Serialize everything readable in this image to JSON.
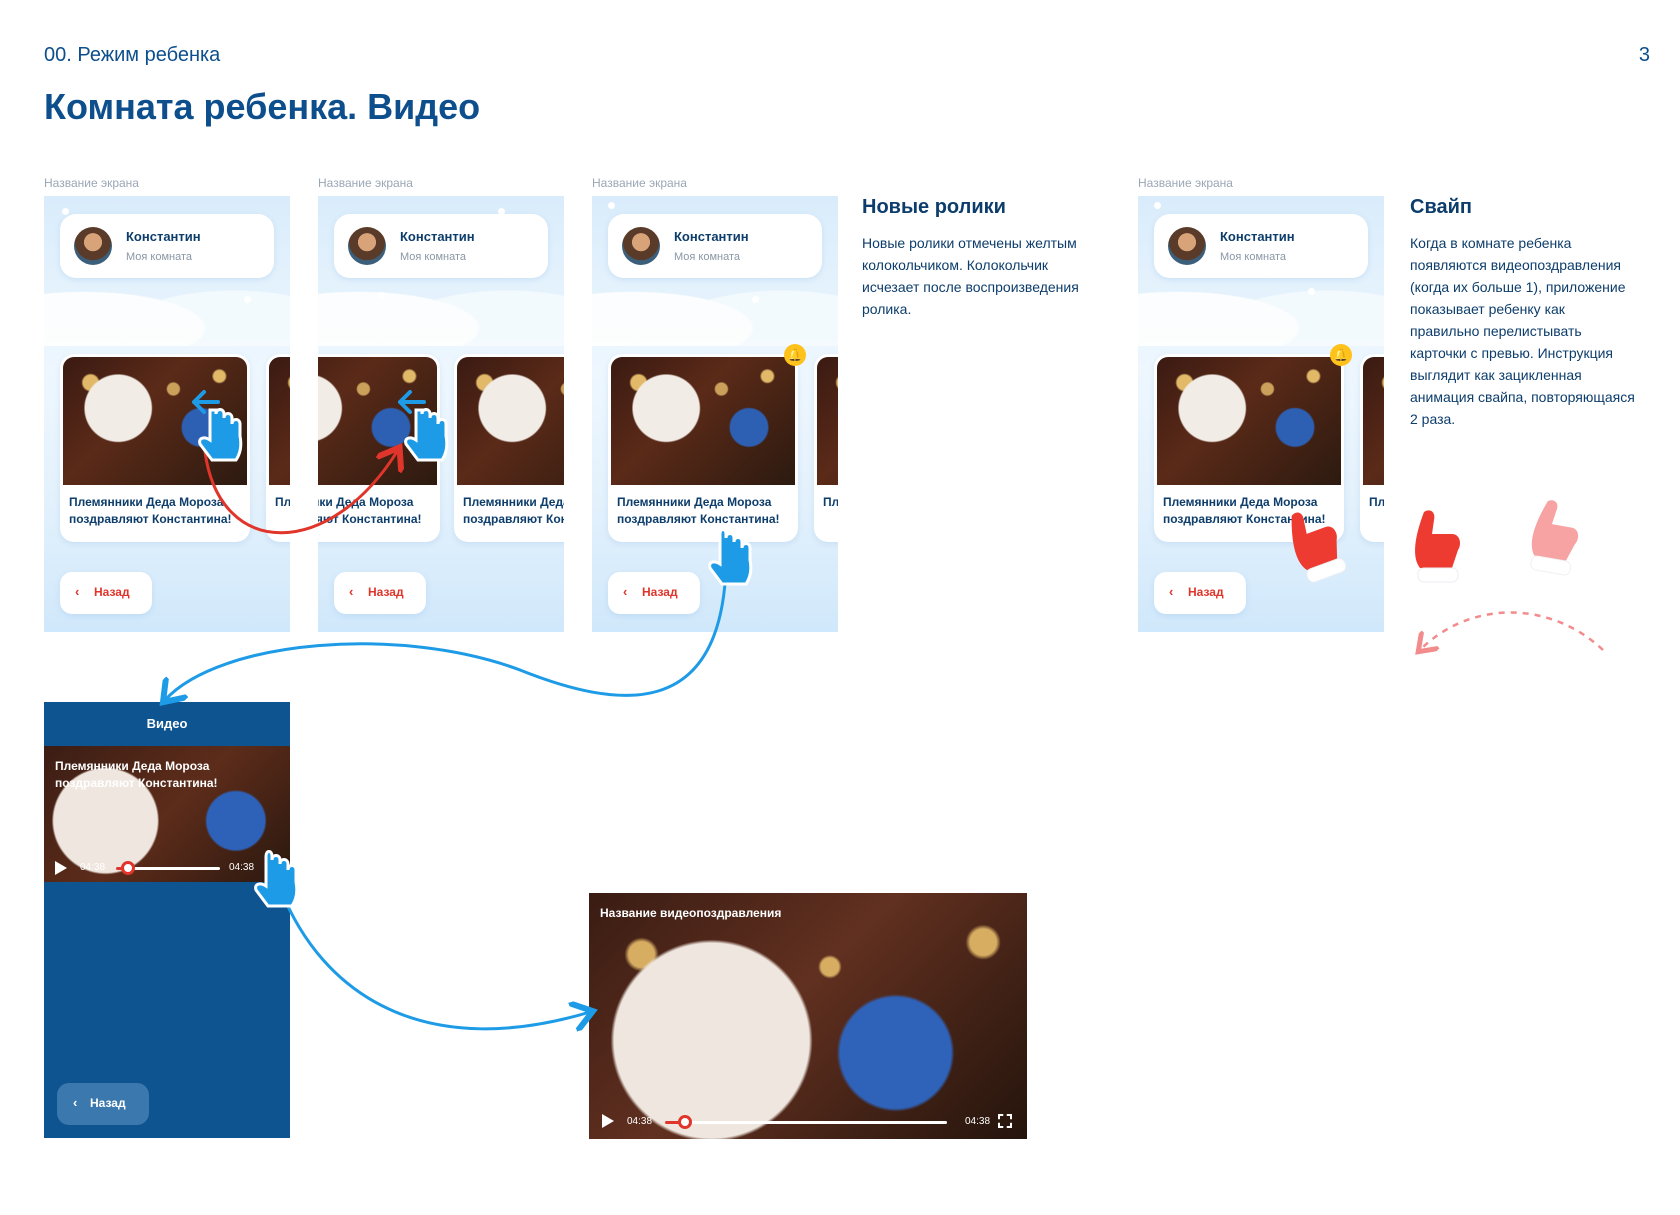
{
  "header": {
    "section": "00. Режим ребенка",
    "page_number": "3",
    "title": "Комната ребенка. Видео"
  },
  "screen_caption": "Название экрана",
  "profile": {
    "name": "Константин",
    "subtitle": "Моя комната"
  },
  "card": {
    "title": "Племянники Деда Мороза поздравляют Константина!",
    "next_title": "Пл по"
  },
  "back_label": "Назад",
  "notes": {
    "new_videos": {
      "title": "Новые ролики",
      "text": "Новые ролики отмечены желтым колокольчиком. Колокольчик исчезает после воспроизведения ролика."
    },
    "swipe": {
      "title": "Свайп",
      "text": "Когда в комнате ребенка появляются видеопоздравления (когда их больше 1), приложение показывает ребенку как правильно перелистывать карточки с превью. Инструкция выглядит как зацикленная анимация свайпа, повторяющаяся 2 раза."
    }
  },
  "video_screen": {
    "header": "Видео",
    "video_title": "Племянники Деда Мороза поздравляют Константина!",
    "time_start": "04:38",
    "time_end": "04:38",
    "progress": 0.12
  },
  "landscape": {
    "title": "Название видеопоздравления",
    "time_start": "04:38",
    "time_end": "04:38",
    "progress": 0.07
  },
  "colors": {
    "brand_blue": "#0d4e8c",
    "accent_red": "#e0352b",
    "bell_yellow": "#ffc21a",
    "pointer_blue": "#1e9be6"
  }
}
